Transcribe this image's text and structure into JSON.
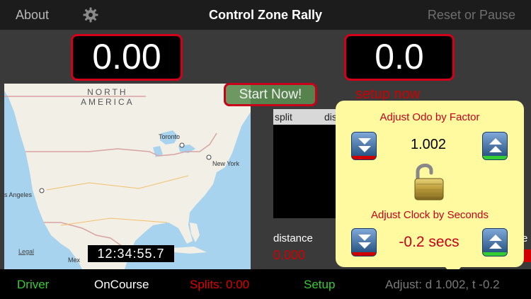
{
  "navbar": {
    "about_label": "About",
    "gear_icon": "gear-icon",
    "title": "Control Zone Rally",
    "reset_label": "Reset or Pause"
  },
  "readouts": {
    "time": "0.00",
    "distance": "0.0"
  },
  "map": {
    "continent_line1": "NORTH",
    "continent_line2": "AMERICA",
    "cities": {
      "toronto": "Toronto",
      "new_york": "New York",
      "los_angeles": "s Angeles",
      "mexico": "Mex"
    },
    "legal_label": "Legal",
    "clock": "12:34:55.7"
  },
  "start_button_label": "Start Now!",
  "setup_now_label": "setup now",
  "split_table": {
    "columns": [
      "split",
      "dis"
    ]
  },
  "readings": {
    "distance_label": "distance",
    "distance_value": "0.000",
    "edge_label": "e"
  },
  "popover": {
    "odo_title": "Adjust Odo by Factor",
    "odo_value": "1.002",
    "clock_title": "Adjust Clock by Seconds",
    "clock_value": "-0.2 secs",
    "lock_icon": "padlock-open-icon"
  },
  "tabs": {
    "driver": "Driver",
    "oncourse": "OnCourse",
    "splits": "Splits: 0:00",
    "setup": "Setup",
    "adjust": "Adjust: d 1.002, t -0.2"
  },
  "colors": {
    "red": "#d10000",
    "green": "#33cc33",
    "popover_bg": "#fffaa0",
    "readout_border": "#d4001a"
  }
}
